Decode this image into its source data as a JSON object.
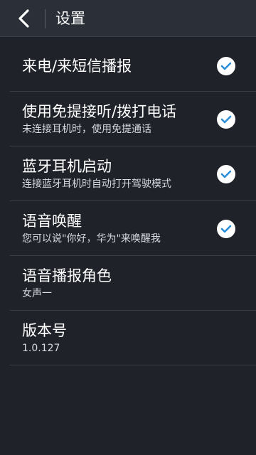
{
  "header": {
    "back_icon": "chevron-left-icon",
    "title": "设置"
  },
  "settings": [
    {
      "title": "来电/来短信播报",
      "subtitle": "",
      "checked": true
    },
    {
      "title": "使用免提接听/拨打电话",
      "subtitle": "未连接耳机时，使用免提通话",
      "checked": true
    },
    {
      "title": "蓝牙耳机启动",
      "subtitle": "连接蓝牙耳机时自动打开驾驶模式",
      "checked": true
    },
    {
      "title": "语音唤醒",
      "subtitle": "您可以说\"你好，华为\"来唤醒我",
      "checked": true
    },
    {
      "title": "语音播报角色",
      "subtitle": "女声一",
      "checked": false
    },
    {
      "title": "版本号",
      "subtitle": "1.0.127",
      "checked": false
    }
  ],
  "colors": {
    "background": "#1f2229",
    "titlebar": "#2b3038",
    "check_accent": "#2a8fd8"
  }
}
